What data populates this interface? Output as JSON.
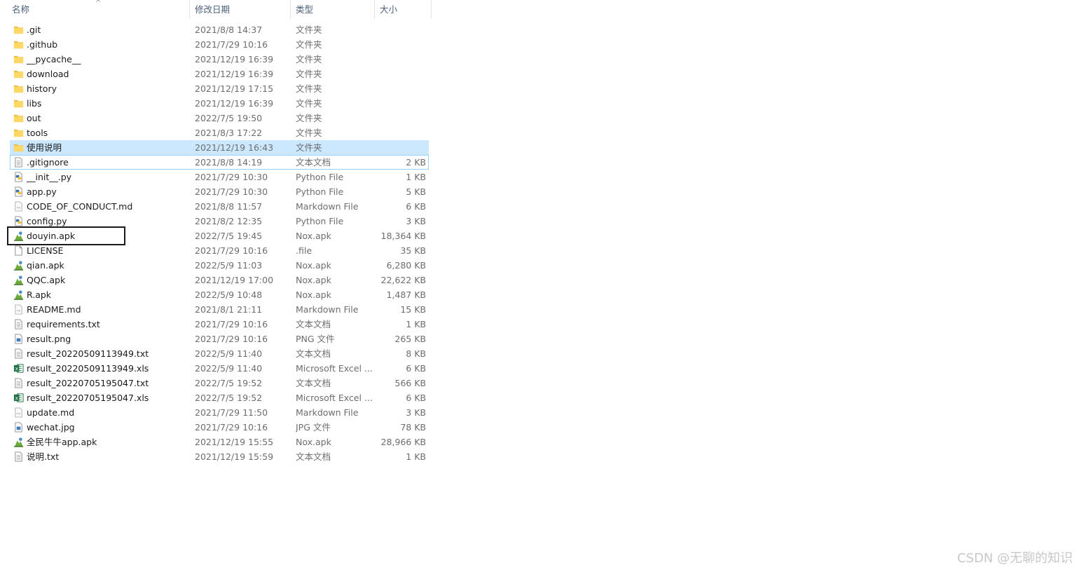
{
  "columns": {
    "name": "名称",
    "date": "修改日期",
    "type": "类型",
    "size": "大小"
  },
  "sort_arrow": "^",
  "files": [
    {
      "name": ".git",
      "date": "2021/8/8 14:37",
      "type": "文件夹",
      "size": "",
      "icon": "folder-icon"
    },
    {
      "name": ".github",
      "date": "2021/7/29 10:16",
      "type": "文件夹",
      "size": "",
      "icon": "folder-icon"
    },
    {
      "name": "__pycache__",
      "date": "2021/12/19 16:39",
      "type": "文件夹",
      "size": "",
      "icon": "folder-icon"
    },
    {
      "name": "download",
      "date": "2021/12/19 16:39",
      "type": "文件夹",
      "size": "",
      "icon": "folder-icon"
    },
    {
      "name": "history",
      "date": "2021/12/19 17:15",
      "type": "文件夹",
      "size": "",
      "icon": "folder-icon"
    },
    {
      "name": "libs",
      "date": "2021/12/19 16:39",
      "type": "文件夹",
      "size": "",
      "icon": "folder-icon"
    },
    {
      "name": "out",
      "date": "2022/7/5 19:50",
      "type": "文件夹",
      "size": "",
      "icon": "folder-icon"
    },
    {
      "name": "tools",
      "date": "2021/8/3 17:22",
      "type": "文件夹",
      "size": "",
      "icon": "folder-icon"
    },
    {
      "name": "使用说明",
      "date": "2021/12/19 16:43",
      "type": "文件夹",
      "size": "",
      "icon": "folder-icon",
      "state": "selected"
    },
    {
      "name": ".gitignore",
      "date": "2021/8/8 14:19",
      "type": "文本文档",
      "size": "2 KB",
      "icon": "text-file-icon",
      "state": "focused"
    },
    {
      "name": "__init__.py",
      "date": "2021/7/29 10:30",
      "type": "Python File",
      "size": "1 KB",
      "icon": "python-file-icon"
    },
    {
      "name": "app.py",
      "date": "2021/7/29 10:30",
      "type": "Python File",
      "size": "5 KB",
      "icon": "python-file-icon"
    },
    {
      "name": "CODE_OF_CONDUCT.md",
      "date": "2021/8/8 11:57",
      "type": "Markdown File",
      "size": "6 KB",
      "icon": "markdown-file-icon"
    },
    {
      "name": "config.py",
      "date": "2021/8/2 12:35",
      "type": "Python File",
      "size": "3 KB",
      "icon": "python-file-icon"
    },
    {
      "name": "douyin.apk",
      "date": "2022/7/5 19:45",
      "type": "Nox.apk",
      "size": "18,364 KB",
      "icon": "apk-file-icon"
    },
    {
      "name": "LICENSE",
      "date": "2021/7/29 10:16",
      "type": ".file",
      "size": "35 KB",
      "icon": "blank-file-icon"
    },
    {
      "name": "qian.apk",
      "date": "2022/5/9 11:03",
      "type": "Nox.apk",
      "size": "6,280 KB",
      "icon": "apk-file-icon"
    },
    {
      "name": "QQC.apk",
      "date": "2021/12/19 17:00",
      "type": "Nox.apk",
      "size": "22,622 KB",
      "icon": "apk-file-icon"
    },
    {
      "name": "R.apk",
      "date": "2022/5/9 10:48",
      "type": "Nox.apk",
      "size": "1,487 KB",
      "icon": "apk-file-icon"
    },
    {
      "name": "README.md",
      "date": "2021/8/1 21:11",
      "type": "Markdown File",
      "size": "15 KB",
      "icon": "markdown-file-icon"
    },
    {
      "name": "requirements.txt",
      "date": "2021/7/29 10:16",
      "type": "文本文档",
      "size": "1 KB",
      "icon": "text-file-icon"
    },
    {
      "name": "result.png",
      "date": "2021/7/29 10:16",
      "type": "PNG 文件",
      "size": "265 KB",
      "icon": "image-file-icon"
    },
    {
      "name": "result_20220509113949.txt",
      "date": "2022/5/9 11:40",
      "type": "文本文档",
      "size": "8 KB",
      "icon": "text-file-icon"
    },
    {
      "name": "result_20220509113949.xls",
      "date": "2022/5/9 11:40",
      "type": "Microsoft Excel ...",
      "size": "6 KB",
      "icon": "excel-file-icon"
    },
    {
      "name": "result_20220705195047.txt",
      "date": "2022/7/5 19:52",
      "type": "文本文档",
      "size": "566 KB",
      "icon": "text-file-icon"
    },
    {
      "name": "result_20220705195047.xls",
      "date": "2022/7/5 19:52",
      "type": "Microsoft Excel ...",
      "size": "6 KB",
      "icon": "excel-file-icon"
    },
    {
      "name": "update.md",
      "date": "2021/7/29 11:50",
      "type": "Markdown File",
      "size": "3 KB",
      "icon": "markdown-file-icon"
    },
    {
      "name": "wechat.jpg",
      "date": "2021/7/29 10:16",
      "type": "JPG 文件",
      "size": "78 KB",
      "icon": "image-file-icon"
    },
    {
      "name": "全民牛牛app.apk",
      "date": "2021/12/19 15:55",
      "type": "Nox.apk",
      "size": "28,966 KB",
      "icon": "apk-file-icon"
    },
    {
      "name": "说明.txt",
      "date": "2021/12/19 15:59",
      "type": "文本文档",
      "size": "1 KB",
      "icon": "text-file-icon"
    }
  ],
  "watermark": "CSDN @无聊的知识",
  "colors": {
    "selected_bg": "#cce8ff",
    "focus_border": "#99d1ff",
    "header_text": "#4c607a",
    "folder": "#ffd764",
    "excel": "#1e7145",
    "apk": "#6cab3c"
  }
}
